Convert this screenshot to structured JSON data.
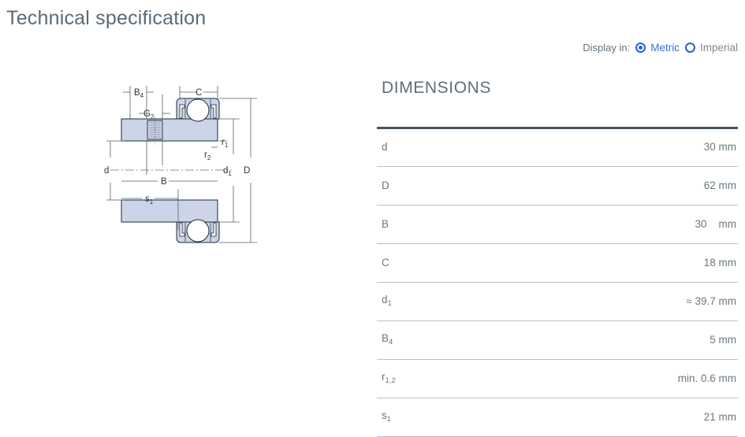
{
  "page": {
    "title": "Technical specification"
  },
  "units": {
    "label": "Display in:",
    "options": [
      {
        "label": "Metric",
        "selected": true
      },
      {
        "label": "Imperial",
        "selected": false
      }
    ]
  },
  "spec": {
    "heading": "DIMENSIONS",
    "rows": [
      {
        "symbol": "d",
        "sub": "",
        "value": "30 mm"
      },
      {
        "symbol": "D",
        "sub": "",
        "value": "62 mm"
      },
      {
        "symbol": "B",
        "sub": "",
        "value": "30    mm"
      },
      {
        "symbol": "C",
        "sub": "",
        "value": "18 mm"
      },
      {
        "symbol": "d",
        "sub": "1",
        "value": "≈ 39.7 mm"
      },
      {
        "symbol": "B",
        "sub": "4",
        "value": "5 mm"
      },
      {
        "symbol": "r",
        "sub": "1,2",
        "value": "min. 0.6 mm"
      },
      {
        "symbol": "s",
        "sub": "1",
        "value": "21 mm"
      }
    ]
  },
  "drawing": {
    "name": "bearing-cross-section-drawing",
    "labels": {
      "b4": "B",
      "b4_sub": "4",
      "c": "C",
      "g2": "G",
      "g2_sub": "2",
      "r1": "r",
      "r1_sub": "1",
      "r2": "r",
      "r2_sub": "2",
      "b": "B",
      "d": "d",
      "d1": "d",
      "d1_sub": "1",
      "dd": "D",
      "s1": "s",
      "s1_sub": "1"
    },
    "colors": {
      "fill": "#ccd4e8",
      "outline": "#1c2a35",
      "dimline": "#555f66"
    }
  }
}
